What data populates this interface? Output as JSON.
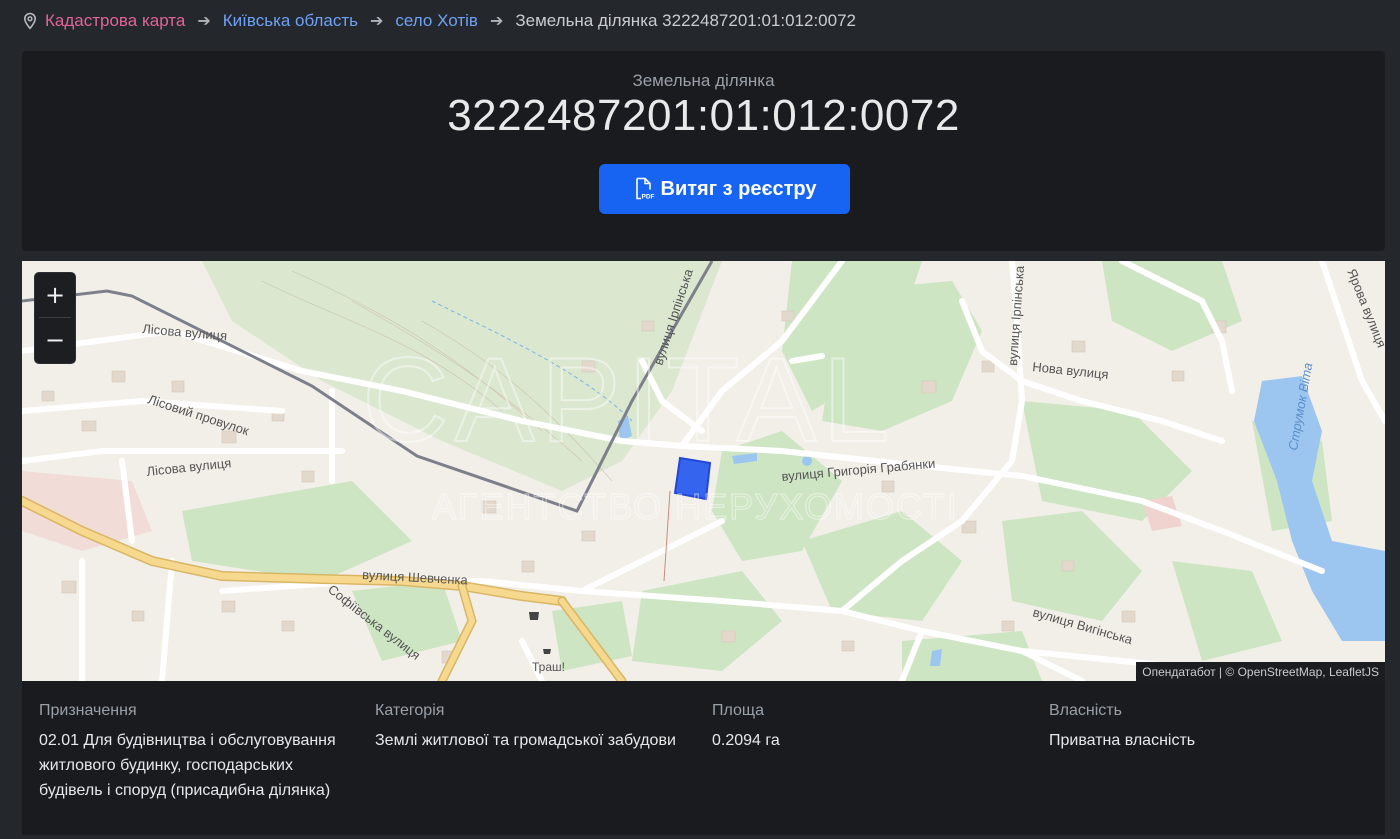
{
  "breadcrumb": {
    "items": [
      {
        "label": "Кадастрова карта"
      },
      {
        "label": "Київська область"
      },
      {
        "label": "село Хотів"
      },
      {
        "label": "Земельна ділянка 3222487201:01:012:0072"
      }
    ]
  },
  "hero": {
    "subtitle": "Земельна ділянка",
    "title": "3222487201:01:012:0072",
    "pdf_button_label": "Витяг з реєстру"
  },
  "map": {
    "zoom_in": "+",
    "zoom_out": "−",
    "watermark_top": "CAPITAL",
    "watermark_bottom": "АГЕНТСТВО НЕРУХОМОСТІ",
    "streets": [
      "Лісова вулиця",
      "Лісовий провулок",
      "Лісова вулиця",
      "вулиця Ірпінська",
      "вулиця Григорія Грабянки",
      "вулиця Шевченка",
      "Софіївська вулиця",
      "вулиця Ірпінська",
      "Нова вулиця",
      "вулиця Вигінська",
      "Ярова вулиця",
      "Струмок Віта",
      "Траш!"
    ],
    "attribution": {
      "part1": "Опендатабот",
      "separator": " | © ",
      "osm": "OpenStreetMap",
      "comma": ", ",
      "leaflet": "LeafletJS"
    },
    "colors": {
      "parcel": "#1f4fe8",
      "water": "#9cc6f0",
      "green": "#c9e3bd",
      "road_yellow": "#f4d68a"
    }
  },
  "info": {
    "purpose_label": "Призначення",
    "purpose_value": "02.01 Для будівництва і обслуговування житлового будинку, господарських будівель і споруд (присадибна ділянка)",
    "category_label": "Категорія",
    "category_value": "Землі житлової та громадської забудови",
    "area_label": "Площа",
    "area_value": "0.2094 га",
    "ownership_label": "Власність",
    "ownership_value": "Приватна власність"
  }
}
